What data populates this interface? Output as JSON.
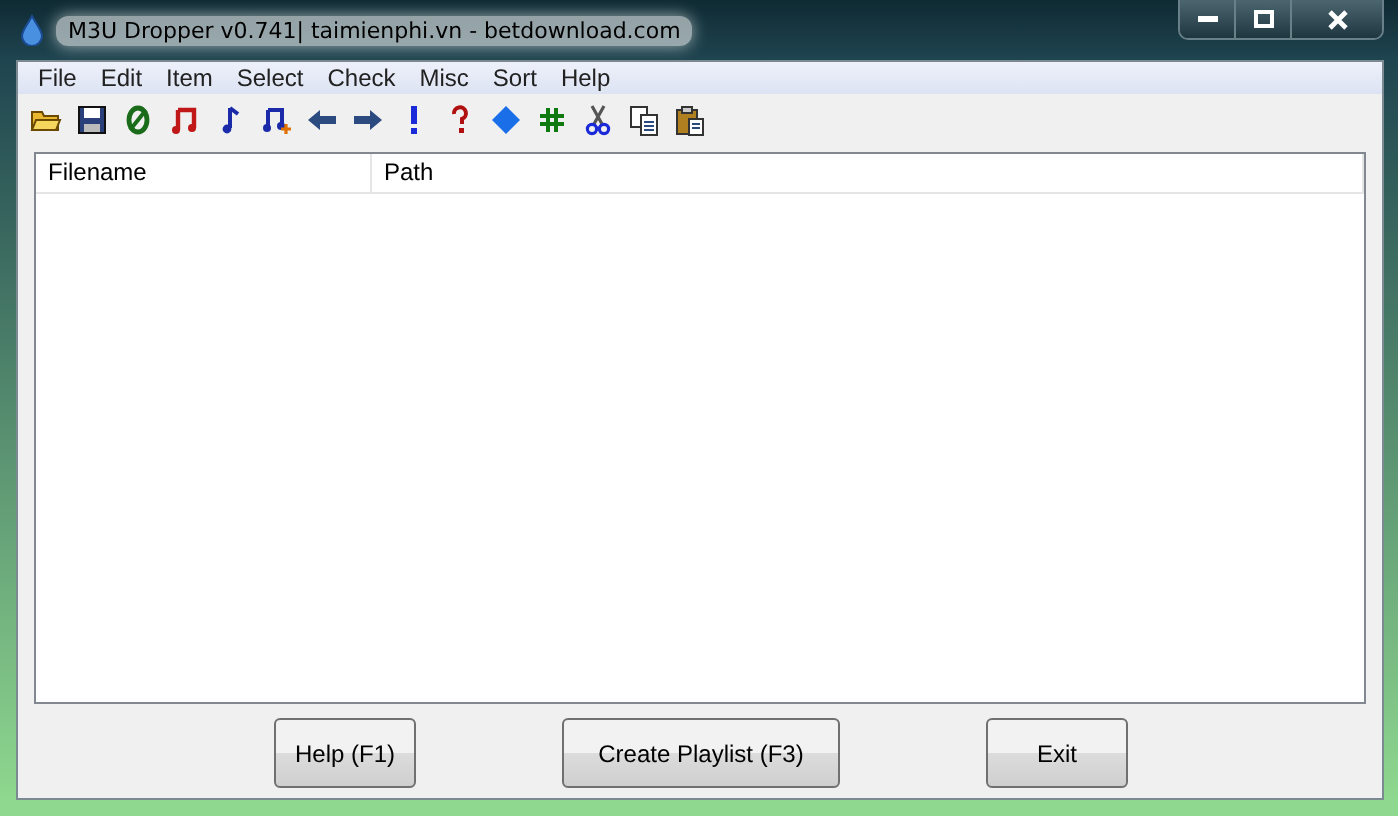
{
  "window": {
    "title": "M3U Dropper v0.741| taimienphi.vn - betdownload.com"
  },
  "menu": [
    "File",
    "Edit",
    "Item",
    "Select",
    "Check",
    "Misc",
    "Sort",
    "Help"
  ],
  "toolbar": [
    {
      "kind": "open"
    },
    {
      "kind": "save"
    },
    {
      "kind": "zero"
    },
    {
      "kind": "note-red"
    },
    {
      "kind": "note-blue"
    },
    {
      "kind": "note-add"
    },
    {
      "kind": "left"
    },
    {
      "kind": "right"
    },
    {
      "kind": "exclaim"
    },
    {
      "kind": "question"
    },
    {
      "kind": "diamond"
    },
    {
      "kind": "hash"
    },
    {
      "kind": "cut"
    },
    {
      "kind": "copy"
    },
    {
      "kind": "paste"
    }
  ],
  "table": {
    "columns": [
      "Filename",
      "Path"
    ]
  },
  "buttons": [
    "Help (F1)",
    "Create Playlist (F3)",
    "Exit"
  ]
}
